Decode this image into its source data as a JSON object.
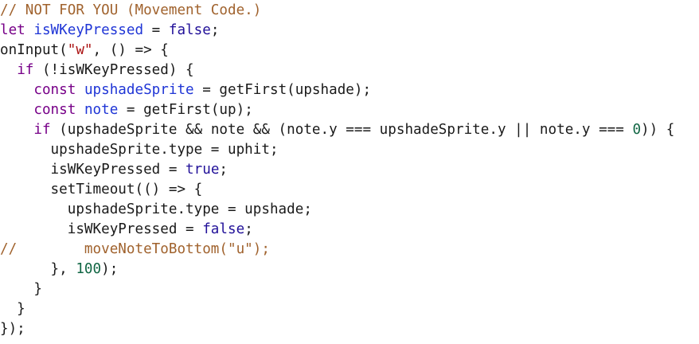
{
  "editor": {
    "lines": [
      [
        [
          "comment",
          "// NOT FOR YOU (Movement Code.)"
        ]
      ],
      [
        [
          "keyword",
          "let"
        ],
        [
          "plain",
          " "
        ],
        [
          "def",
          "isWKeyPressed"
        ],
        [
          "plain",
          " = "
        ],
        [
          "atom",
          "false"
        ],
        [
          "plain",
          ";"
        ]
      ],
      [
        [
          "plain",
          "onInput("
        ],
        [
          "string",
          "\"w\""
        ],
        [
          "plain",
          ", () => {"
        ]
      ],
      [
        [
          "plain",
          "  "
        ],
        [
          "keyword",
          "if"
        ],
        [
          "plain",
          " (!isWKeyPressed) {"
        ]
      ],
      [
        [
          "plain",
          "    "
        ],
        [
          "keyword",
          "const"
        ],
        [
          "plain",
          " "
        ],
        [
          "def",
          "upshadeSprite"
        ],
        [
          "plain",
          " = getFirst(upshade);"
        ]
      ],
      [
        [
          "plain",
          "    "
        ],
        [
          "keyword",
          "const"
        ],
        [
          "plain",
          " "
        ],
        [
          "def",
          "note"
        ],
        [
          "plain",
          " = getFirst(up);"
        ]
      ],
      [
        [
          "plain",
          "    "
        ],
        [
          "keyword",
          "if"
        ],
        [
          "plain",
          " (upshadeSprite && note && (note.y === upshadeSprite.y || note.y === "
        ],
        [
          "number",
          "0"
        ],
        [
          "plain",
          ")) {"
        ]
      ],
      [
        [
          "plain",
          "      upshadeSprite.type = uphit;"
        ]
      ],
      [
        [
          "plain",
          "      isWKeyPressed = "
        ],
        [
          "atom",
          "true"
        ],
        [
          "plain",
          ";"
        ]
      ],
      [
        [
          "plain",
          "      setTimeout(() => {"
        ]
      ],
      [
        [
          "plain",
          "        upshadeSprite.type = upshade;"
        ]
      ],
      [
        [
          "plain",
          "        isWKeyPressed = "
        ],
        [
          "atom",
          "false"
        ],
        [
          "plain",
          ";"
        ]
      ],
      [
        [
          "comment",
          "//        moveNoteToBottom(\"u\");"
        ]
      ],
      [
        [
          "plain",
          "      }, "
        ],
        [
          "number",
          "100"
        ],
        [
          "plain",
          ");"
        ]
      ],
      [
        [
          "plain",
          "    }"
        ]
      ],
      [
        [
          "plain",
          "  }"
        ]
      ],
      [
        [
          "plain",
          "});"
        ]
      ]
    ]
  }
}
